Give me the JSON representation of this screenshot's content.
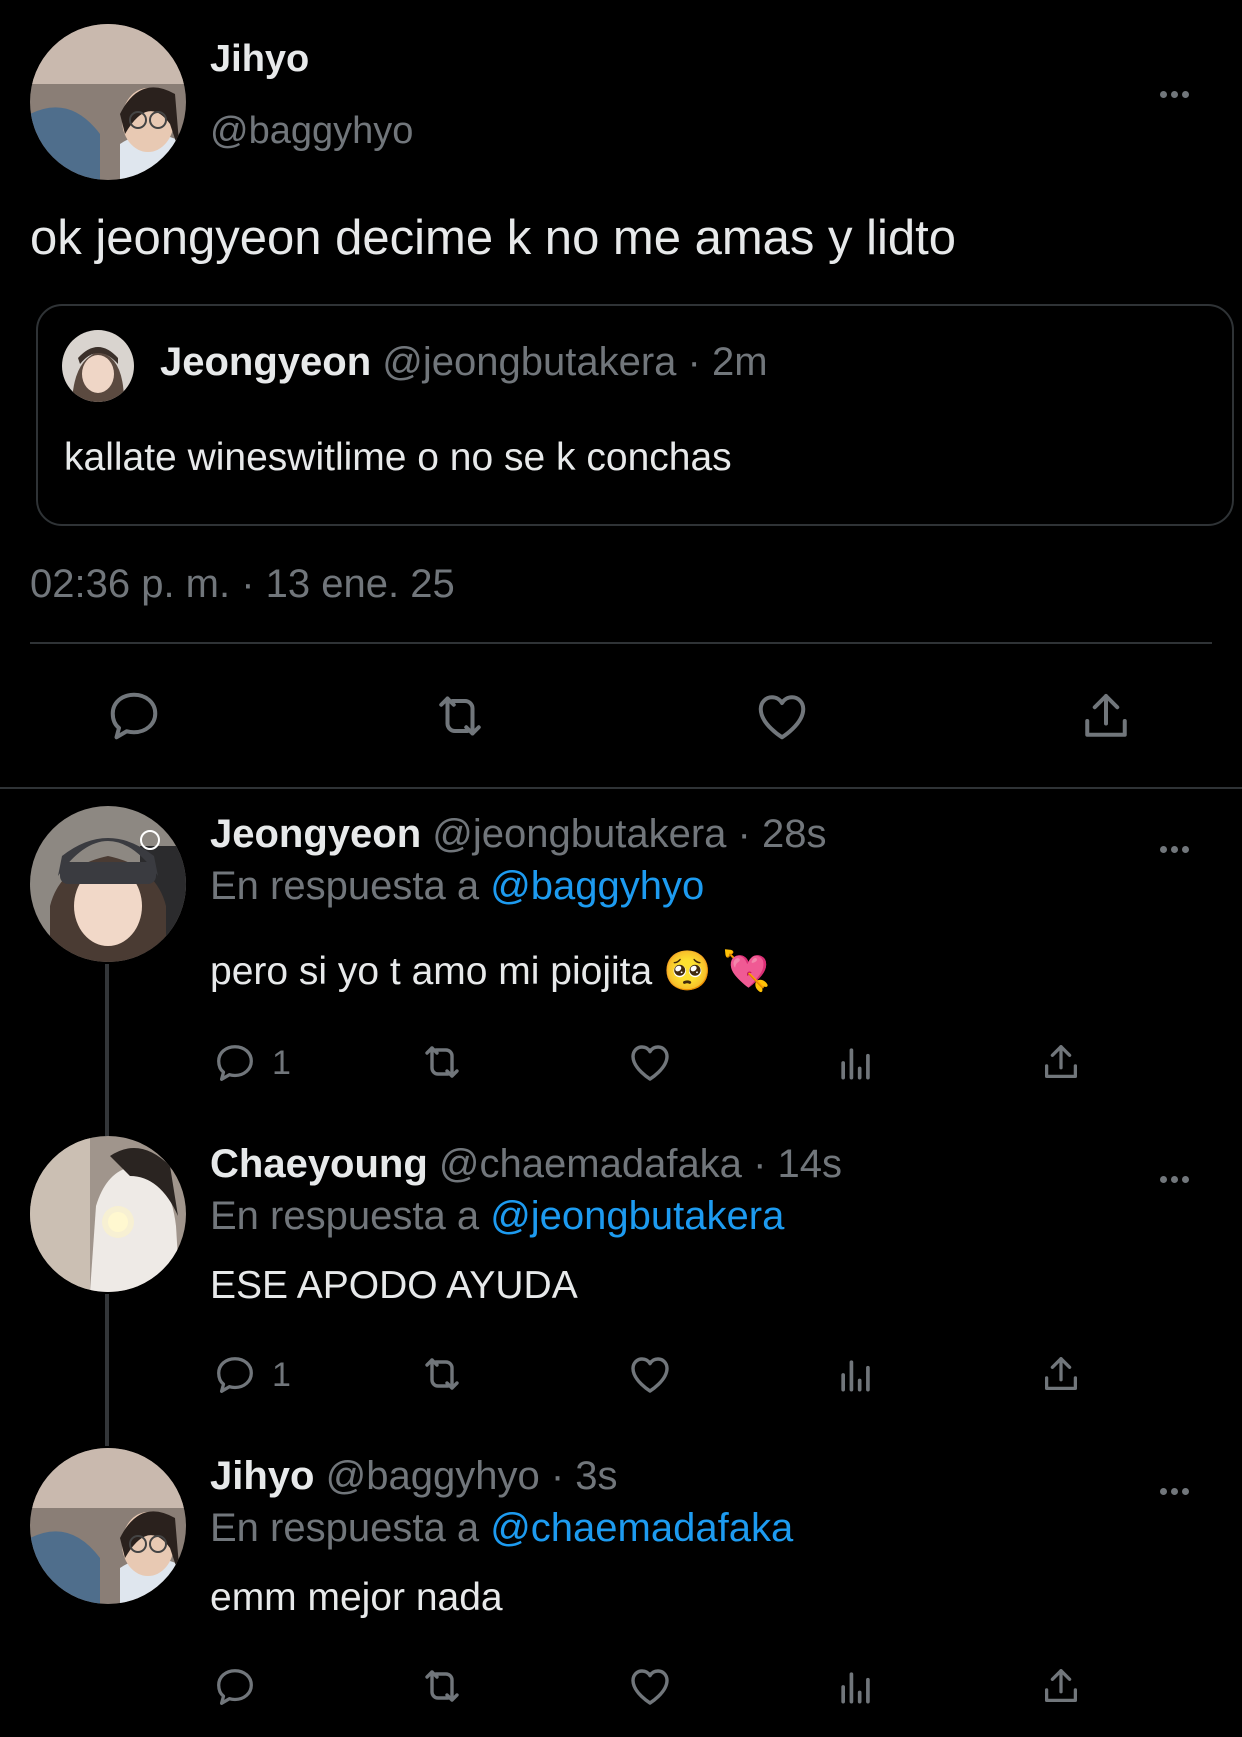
{
  "main_tweet": {
    "author_name": "Jihyo",
    "author_handle": "@baggyhyo",
    "text": "ok jeongyeon decime k no me amas y lidto",
    "timestamp": "02:36 p. m. · 13 ene. 25",
    "quote": {
      "author_name": "Jeongyeon",
      "author_handle": "@jeongbutakera",
      "time": "· 2m",
      "text": "kallate wineswitlime o no se k conchas"
    }
  },
  "replies": [
    {
      "author_name": "Jeongyeon",
      "author_handle": "@jeongbutakera",
      "time": "· 28s",
      "reply_prefix": "En respuesta a",
      "reply_to": "@baggyhyo",
      "text": "pero si yo t amo mi piojita 🥺 💘",
      "reply_count": "1"
    },
    {
      "author_name": "Chaeyoung",
      "author_handle": "@chaemadafaka",
      "time": "· 14s",
      "reply_prefix": "En respuesta a",
      "reply_to": "@jeongbutakera",
      "text": "ESE APODO AYUDA",
      "reply_count": "1"
    },
    {
      "author_name": "Jihyo",
      "author_handle": "@baggyhyo",
      "time": "· 3s",
      "reply_prefix": "En respuesta a",
      "reply_to": "@chaemadafaka",
      "text": "emm mejor nada",
      "reply_count": ""
    }
  ],
  "colors": {
    "background": "#000000",
    "text": "#e7e9ea",
    "muted": "#71767b",
    "link": "#1d9bf0",
    "divider": "#2f3336"
  },
  "icons": [
    "more-icon",
    "reply-icon",
    "retweet-icon",
    "like-icon",
    "views-icon",
    "share-icon"
  ]
}
